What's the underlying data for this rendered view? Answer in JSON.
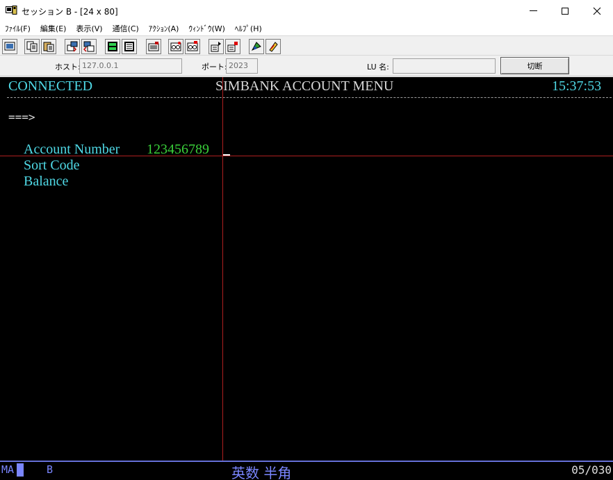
{
  "window": {
    "title": "セッション B - [24 x 80]",
    "controls": {
      "minimize": "minimize-icon",
      "maximize": "maximize-icon",
      "close": "close-icon"
    }
  },
  "menu": {
    "items": [
      "ﾌｧｲﾙ(F)",
      "編集(E)",
      "表示(V)",
      "通信(C)",
      "ｱｸｼｮﾝ(A)",
      "ｳｨﾝﾄﾞｳ(W)",
      "ﾍﾙﾌﾟ(H)"
    ]
  },
  "toolbar": {
    "icons": [
      "print-screen-icon",
      "copy-icon",
      "paste-icon",
      "send-file-icon",
      "receive-file-icon",
      "keypad-icon",
      "keypad-alt-icon",
      "macro-icon",
      "record-icon",
      "play-icon",
      "start-macro-icon",
      "stop-macro-icon",
      "color-icon",
      "settings-icon"
    ]
  },
  "connection": {
    "host_label": "ホスト:",
    "host_value": "127.0.0.1",
    "port_label": "ポート:",
    "port_value": "2023",
    "lu_label": "LU 名:",
    "lu_value": "",
    "disconnect_label": "切断"
  },
  "terminal": {
    "status": "CONNECTED",
    "screen_title": "SIMBANK ACCOUNT MENU",
    "time": "15:37:53",
    "divider": "-------------------------------------------------------------------------------",
    "prompt": "===>",
    "fields": [
      {
        "label": "Account Number",
        "value": "123456789"
      },
      {
        "label": "Sort Code",
        "value": ""
      },
      {
        "label": "Balance",
        "value": ""
      }
    ]
  },
  "statusbar": {
    "mode": "MA",
    "session": "B",
    "ime": "英数 半角",
    "cursor_position": "05/030"
  },
  "colors": {
    "terminal_bg": "#000000",
    "cyan": "#4fd9e6",
    "green": "#3ad13a",
    "crosshair": "#b02020",
    "status_text": "#7a86ff"
  }
}
